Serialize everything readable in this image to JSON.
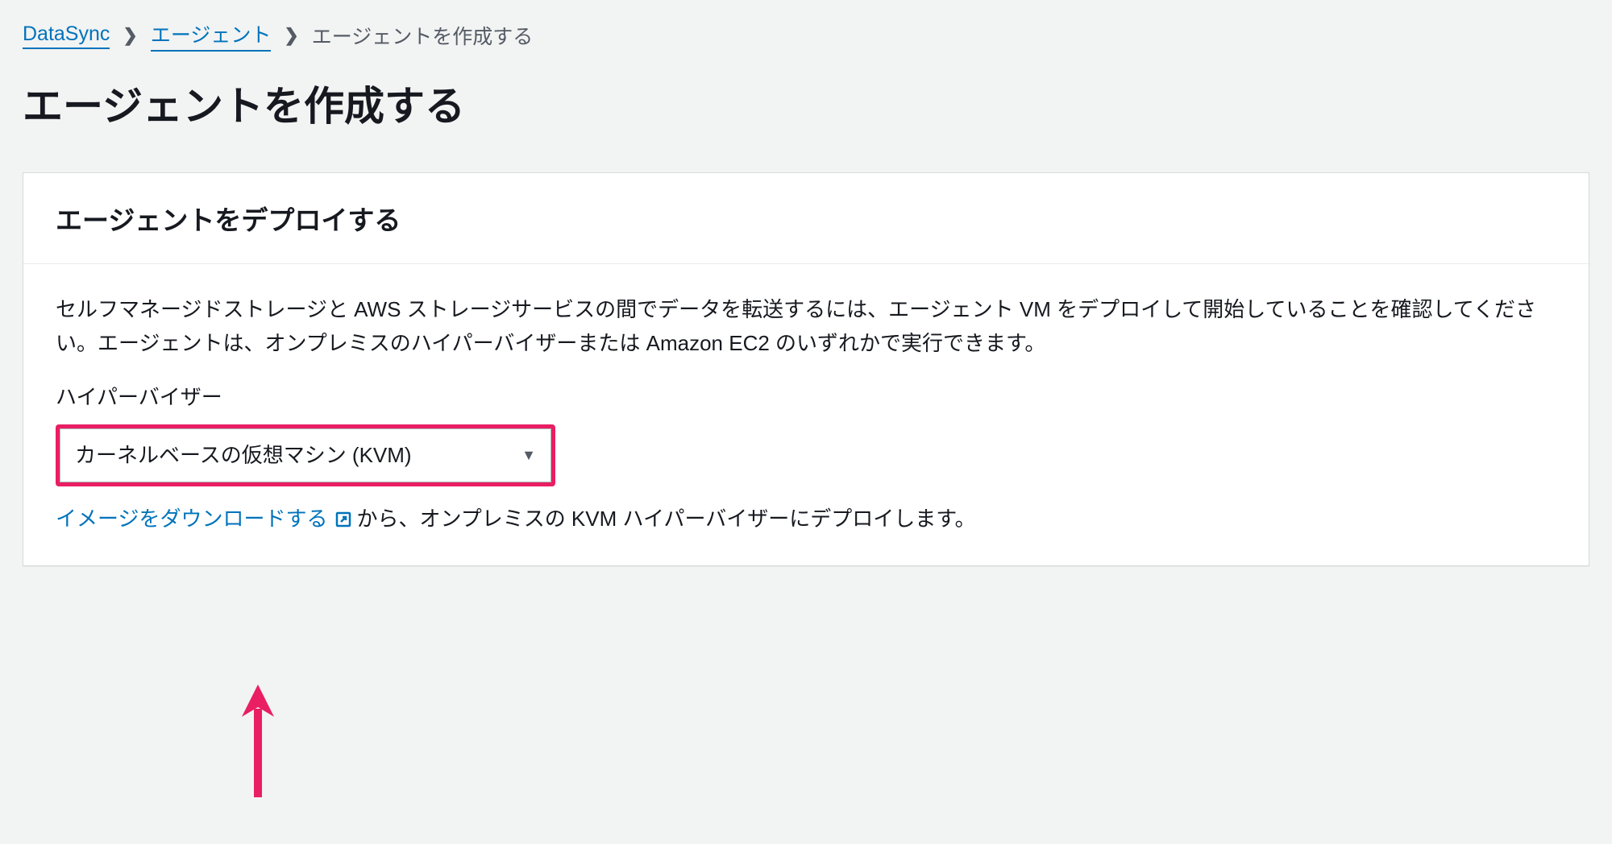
{
  "breadcrumb": {
    "root": "DataSync",
    "agents": "エージェント",
    "current": "エージェントを作成する"
  },
  "page": {
    "title": "エージェントを作成する"
  },
  "card": {
    "header": "エージェントをデプロイする",
    "description": "セルフマネージドストレージと AWS ストレージサービスの間でデータを転送するには、エージェント VM をデプロイして開始していることを確認してください。エージェントは、オンプレミスのハイパーバイザーまたは Amazon EC2 のいずれかで実行できます。",
    "hypervisor_label": "ハイパーバイザー",
    "hypervisor_selected": "カーネルベースの仮想マシン (KVM)",
    "download_link": "イメージをダウンロードする",
    "download_suffix": " から、オンプレミスの KVM ハイパーバイザーにデプロイします。"
  }
}
